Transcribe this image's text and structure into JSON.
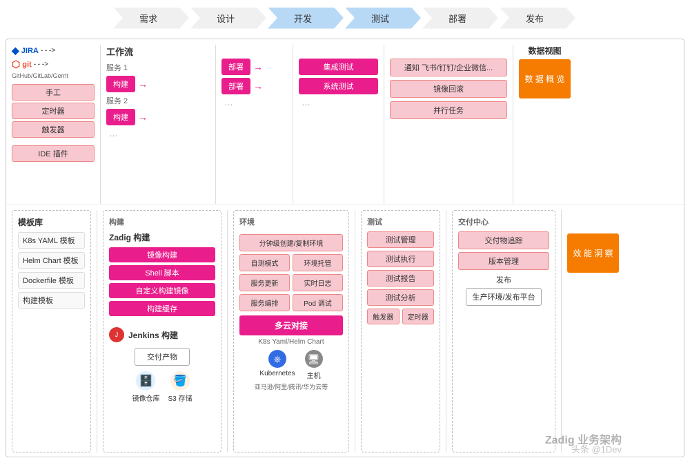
{
  "pipeline": {
    "steps": [
      "需求",
      "设计",
      "开发",
      "测试",
      "部署",
      "发布"
    ],
    "active": "开发"
  },
  "workflow": {
    "title": "工作流",
    "service1": "服务 1",
    "service2": "服务 2",
    "dots": "…",
    "build_label": "构建",
    "deploy_label": "部署",
    "integration_test": "集成测试",
    "system_test": "系统测试"
  },
  "jira": {
    "label": "JIRA",
    "arrow": "→"
  },
  "git": {
    "label": "git",
    "sub": "GitHub/GitLab/Gerrit"
  },
  "triggers": [
    "手工",
    "定时器",
    "触发器"
  ],
  "ide_plugin": "IDE 插件",
  "sections": {
    "template_lib": {
      "title": "模板库",
      "items": [
        "K8s YAML 模板",
        "Helm Chart 模板",
        "Dockerfile 模板",
        "构建模板"
      ]
    },
    "build": {
      "title": "构建",
      "zadig_title": "Zadig 构建",
      "items": [
        "镜像构建",
        "Shell 脚本",
        "自定义构建镜像",
        "构建缓存"
      ],
      "jenkins_title": "Jenkins 构建",
      "delivery_product": "交付产物",
      "image_repo": "镜像仓库",
      "s3_storage": "S3 存储"
    },
    "env": {
      "title": "环境",
      "items": [
        "分钟级创建/复制环境",
        "自测模式",
        "环境托管",
        "服务更新",
        "实时日志",
        "服务编排",
        "Pod 调试"
      ],
      "multi_cloud": "多云对接",
      "k8s_helm": "K8s Yaml/Helm Chart",
      "kubernetes": "Kubernetes",
      "host": "主机",
      "alibaba": "亚马逊/阿里/腾讯/华为云等"
    },
    "test": {
      "title": "测试",
      "items": [
        "测试管理",
        "测试执行",
        "测试报告",
        "测试分析"
      ],
      "footer_items": [
        "触发器",
        "定时器"
      ]
    },
    "delivery": {
      "title": "交付中心",
      "items": [
        "通知\n飞书/钉钉/企业微信...",
        "镜像回滚",
        "并行任务"
      ],
      "items_bottom": [
        "交付物追踪",
        "版本管理"
      ],
      "publish": "发布",
      "production": "生产环境/发布平台"
    },
    "data_view": {
      "title": "数据视图",
      "overview": "数\n据\n概\n览",
      "perf": "效\n能\n洞\n察"
    }
  },
  "watermark": "Zadig 业务架构",
  "watermark2": "头条 @1Dev"
}
